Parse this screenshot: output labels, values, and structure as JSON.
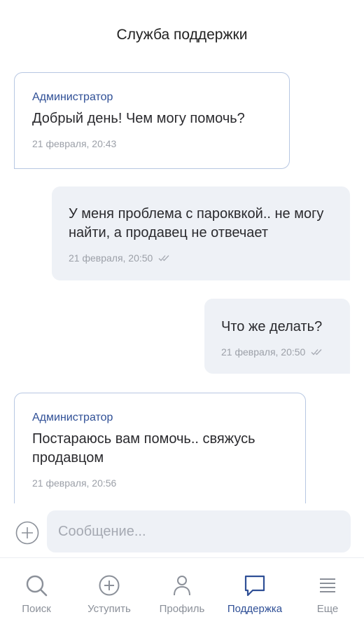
{
  "header": {
    "title": "Служба поддержки"
  },
  "messages": [
    {
      "sender": "Администратор",
      "text": "Добрый день! Чем могу помочь?",
      "time": "21 февраля, 20:43"
    },
    {
      "text": "У меня проблема с пароквкой.. не могу найти, а продавец не отвечает",
      "time": "21 февраля, 20:50"
    },
    {
      "text": "Что же делать?",
      "time": "21 февраля, 20:50"
    },
    {
      "sender": "Администратор",
      "text": "Постараюсь вам помочь.. свяжусь продавцом",
      "time": "21 февраля, 20:56"
    }
  ],
  "composer": {
    "placeholder": "Сообщение...",
    "value": ""
  },
  "tabs": [
    {
      "label": "Поиск",
      "icon": "search-icon"
    },
    {
      "label": "Уступить",
      "icon": "plus-circle-icon"
    },
    {
      "label": "Профиль",
      "icon": "person-icon"
    },
    {
      "label": "Поддержка",
      "icon": "chat-bubble-icon",
      "active": true
    },
    {
      "label": "Еще",
      "icon": "menu-icon"
    }
  ],
  "colors": {
    "accent": "#2f4f96",
    "bubble_out": "#eef1f6",
    "bubble_in_border": "#b7c7e2",
    "muted": "#8b9099"
  }
}
